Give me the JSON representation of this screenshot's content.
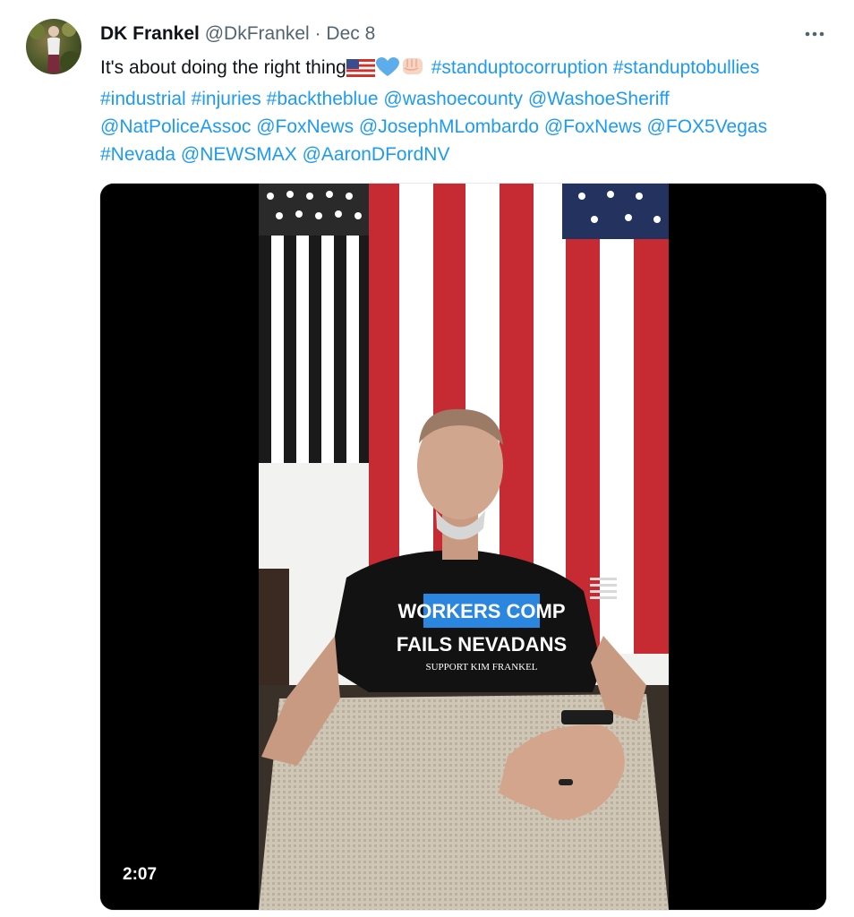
{
  "tweet": {
    "author_name": "DK Frankel",
    "author_handle": "@DkFrankel",
    "separator": "·",
    "date": "Dec 8",
    "text_intro": "It's about doing the right thing",
    "emojis": [
      "us-flag-emoji",
      "blue-heart-emoji",
      "raised-fist-emoji"
    ],
    "tokens": [
      "#standuptocorruption",
      "#standuptobullies",
      "#industrial",
      "#injuries",
      "#backtheblue",
      "@washoecounty",
      "@WashoeSheriff",
      "@NatPoliceAssoc",
      "@FoxNews",
      "@JosephMLombardo",
      "@FoxNews",
      "@FOX5Vegas",
      "#Nevada",
      "@NEWSMAX",
      "@AaronDFordNV"
    ]
  },
  "video": {
    "duration": "2:07",
    "shirt_line1": "WORKERS COMP",
    "shirt_line2": "FAILS NEVADANS",
    "shirt_line3": "SUPPORT KIM FRANKEL"
  },
  "colors": {
    "link": "#1d9bf0",
    "text": "#0f1419",
    "muted": "#536471"
  },
  "icons": {
    "more": "more-options-icon"
  }
}
